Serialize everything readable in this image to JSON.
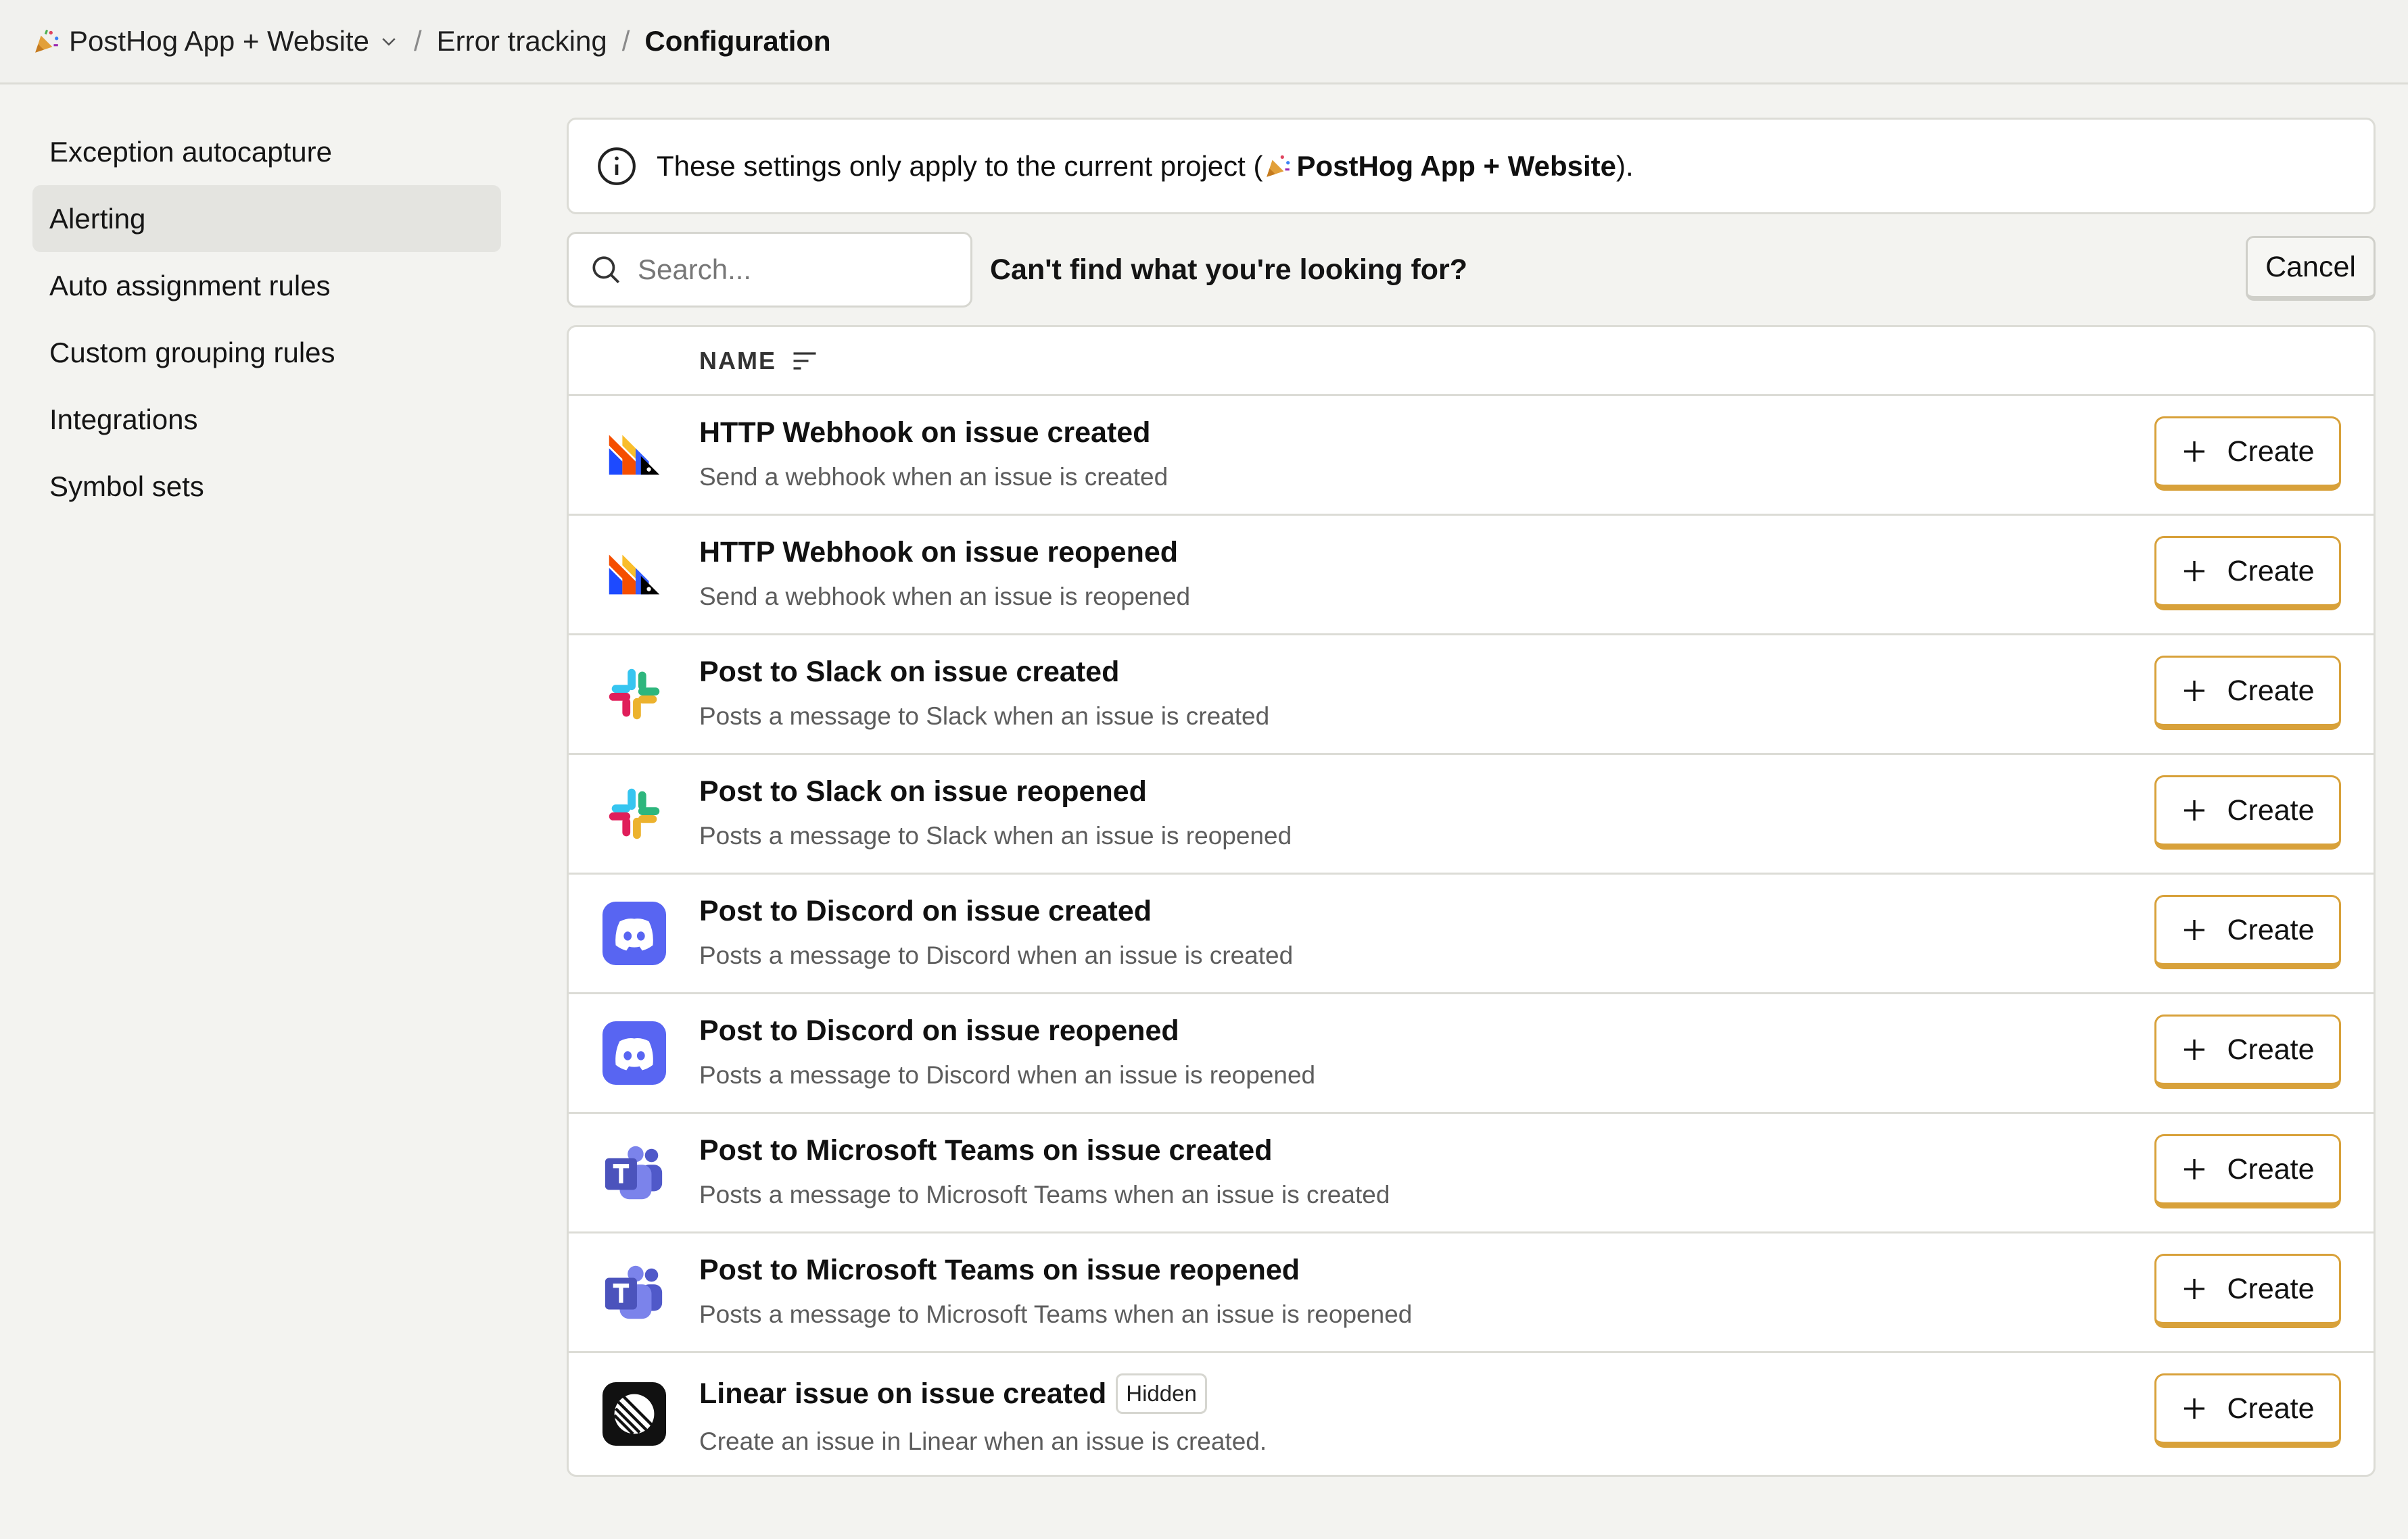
{
  "breadcrumb": {
    "project": "PostHog App + Website",
    "section": "Error tracking",
    "current": "Configuration"
  },
  "sidebar": {
    "items": [
      {
        "label": "Exception autocapture",
        "active": false
      },
      {
        "label": "Alerting",
        "active": true
      },
      {
        "label": "Auto assignment rules",
        "active": false
      },
      {
        "label": "Custom grouping rules",
        "active": false
      },
      {
        "label": "Integrations",
        "active": false
      },
      {
        "label": "Symbol sets",
        "active": false
      }
    ]
  },
  "info": {
    "text_before": "These settings only apply to the current project (",
    "project": "PostHog App + Website",
    "text_after": ")."
  },
  "search": {
    "placeholder": "Search...",
    "cant_find": "Can't find what you're looking for?",
    "cancel_label": "Cancel"
  },
  "table": {
    "column_name": "NAME",
    "create_label": "Create",
    "rows": [
      {
        "icon": "posthog-logo-icon",
        "title": "HTTP Webhook on issue created",
        "subtitle": "Send a webhook when an issue is created",
        "badge": ""
      },
      {
        "icon": "posthog-logo-icon",
        "title": "HTTP Webhook on issue reopened",
        "subtitle": "Send a webhook when an issue is reopened",
        "badge": ""
      },
      {
        "icon": "slack-icon",
        "title": "Post to Slack on issue created",
        "subtitle": "Posts a message to Slack when an issue is created",
        "badge": ""
      },
      {
        "icon": "slack-icon",
        "title": "Post to Slack on issue reopened",
        "subtitle": "Posts a message to Slack when an issue is reopened",
        "badge": ""
      },
      {
        "icon": "discord-icon",
        "title": "Post to Discord on issue created",
        "subtitle": "Posts a message to Discord when an issue is created",
        "badge": ""
      },
      {
        "icon": "discord-icon",
        "title": "Post to Discord on issue reopened",
        "subtitle": "Posts a message to Discord when an issue is reopened",
        "badge": ""
      },
      {
        "icon": "microsoft-teams-icon",
        "title": "Post to Microsoft Teams on issue created",
        "subtitle": "Posts a message to Microsoft Teams when an issue is created",
        "badge": ""
      },
      {
        "icon": "microsoft-teams-icon",
        "title": "Post to Microsoft Teams on issue reopened",
        "subtitle": "Posts a message to Microsoft Teams when an issue is reopened",
        "badge": ""
      },
      {
        "icon": "linear-icon",
        "title": "Linear issue on issue created",
        "subtitle": "Create an issue in Linear when an issue is created.",
        "badge": "Hidden"
      }
    ]
  },
  "colors": {
    "accent_border": "#d8a13a",
    "discord": "#5865f2",
    "teams": "#5059c9"
  }
}
